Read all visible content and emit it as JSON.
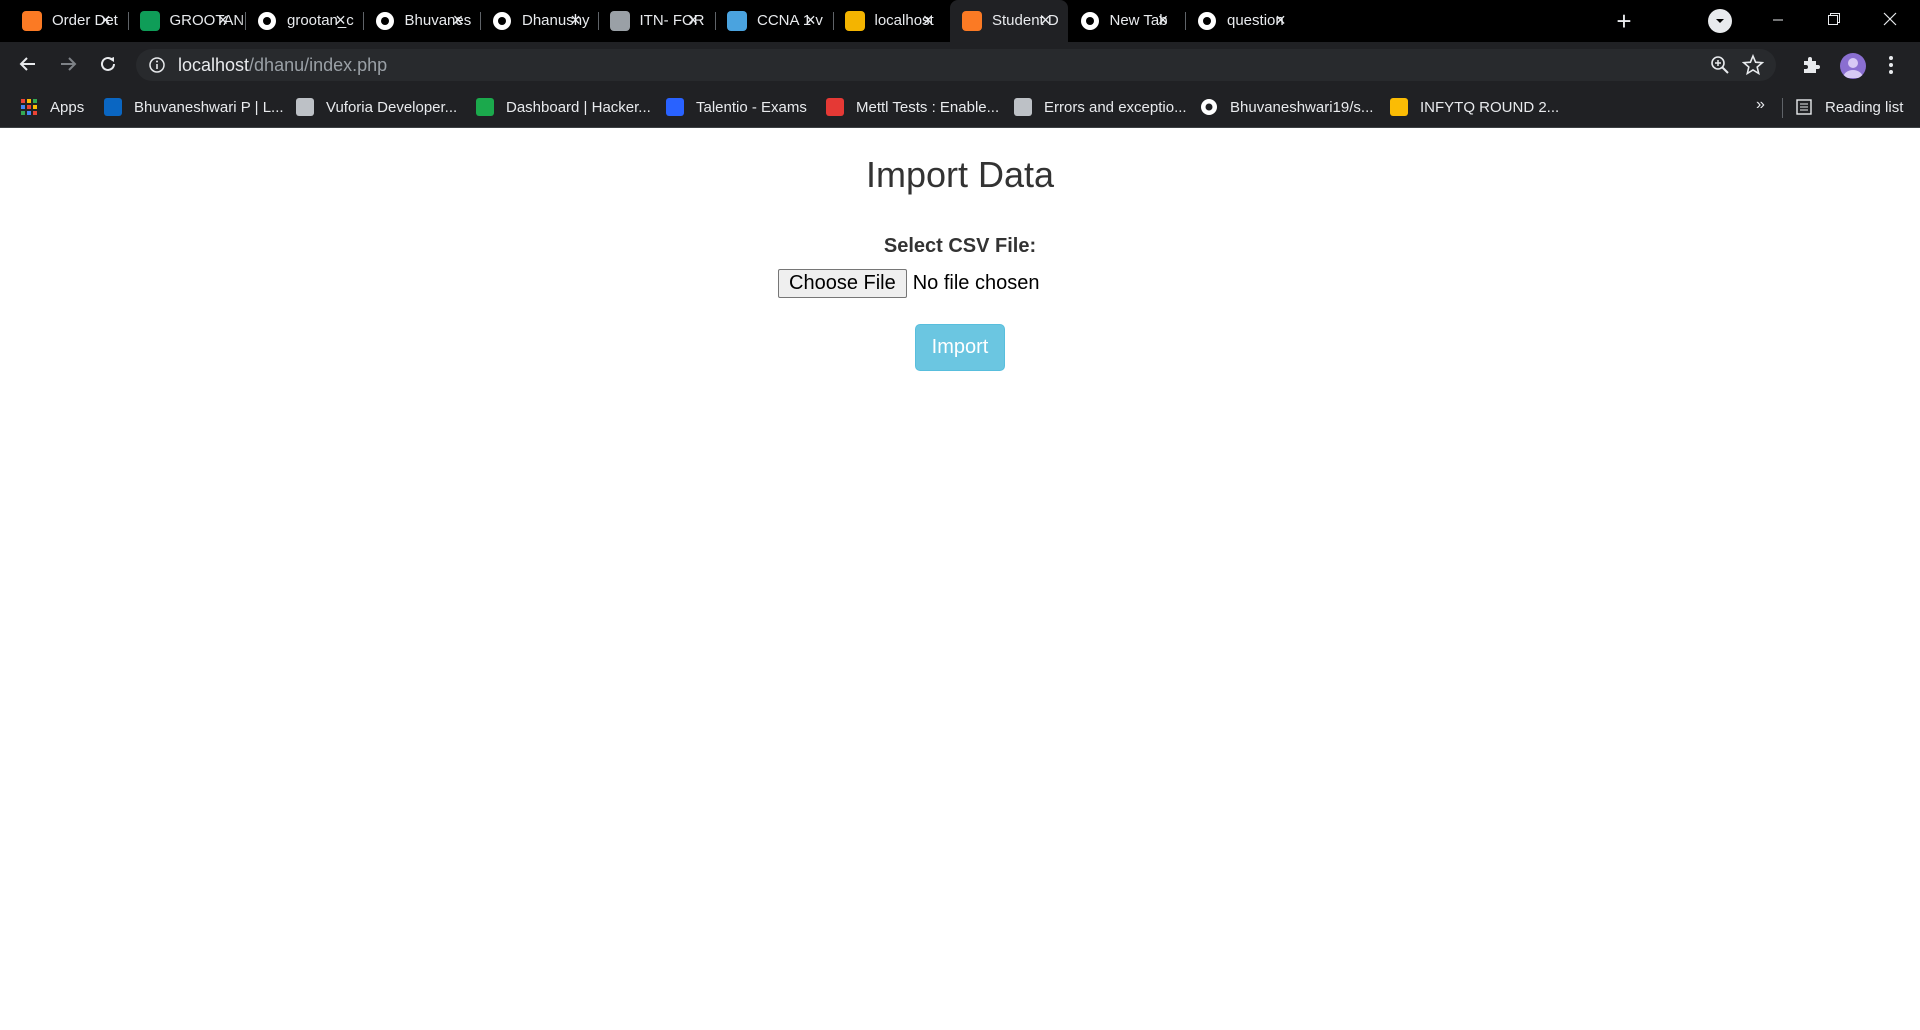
{
  "browser": {
    "tabs": [
      {
        "title": "Order Det",
        "icon": "xampp-icon",
        "color": "#fb7a24",
        "active": false
      },
      {
        "title": "GROOTAN",
        "icon": "sheets-icon",
        "color": "#0f9d58",
        "active": false
      },
      {
        "title": "grootan_c",
        "icon": "github-icon",
        "color": "#ffffff",
        "active": false
      },
      {
        "title": "Bhuvanes",
        "icon": "github-icon",
        "color": "#ffffff",
        "active": false
      },
      {
        "title": "Dhanushy",
        "icon": "github-icon",
        "color": "#ffffff",
        "active": false
      },
      {
        "title": "ITN- FOR",
        "icon": "cisco-icon",
        "color": "#9aa0a6",
        "active": false
      },
      {
        "title": "CCNA 1 v",
        "icon": "ccna-icon",
        "color": "#4aa3df",
        "active": false
      },
      {
        "title": "localhost",
        "icon": "localhost-icon",
        "color": "#f4b400",
        "active": false
      },
      {
        "title": "Student D",
        "icon": "xampp-icon",
        "color": "#fb7a24",
        "active": true
      },
      {
        "title": "New Tab",
        "icon": "chrome-icon",
        "color": "#ffffff",
        "active": false
      },
      {
        "title": "question",
        "icon": "google-icon",
        "color": "#ffffff",
        "active": false
      }
    ],
    "url": {
      "host": "localhost",
      "path": "/dhanu/index.php"
    },
    "bookmarks": [
      {
        "label": "Apps",
        "icon": "apps-grid-icon",
        "color": "#ea4335"
      },
      {
        "label": "Bhuvaneshwari P | L...",
        "icon": "linkedin-icon",
        "color": "#0a66c2"
      },
      {
        "label": "Vuforia Developer...",
        "icon": "vuforia-icon",
        "color": "#bdc1c6"
      },
      {
        "label": "Dashboard | Hacker...",
        "icon": "hackerrank-icon",
        "color": "#1ba94c"
      },
      {
        "label": "Talentio - Exams",
        "icon": "talentio-icon",
        "color": "#2962ff"
      },
      {
        "label": "Mettl Tests : Enable...",
        "icon": "mettl-icon",
        "color": "#e53935"
      },
      {
        "label": "Errors and exceptio...",
        "icon": "document-icon",
        "color": "#bdc1c6"
      },
      {
        "label": "Bhuvaneshwari19/s...",
        "icon": "github-icon",
        "color": "#ffffff"
      },
      {
        "label": "INFYTQ ROUND 2...",
        "icon": "drive-icon",
        "color": "#fbbc04"
      }
    ],
    "more_bookmarks": "»",
    "reading_list": "Reading list"
  },
  "page": {
    "title": "Import Data",
    "file_label": "Select CSV File:",
    "choose_file": "Choose File",
    "no_file": "No file chosen",
    "import_button": "Import"
  }
}
